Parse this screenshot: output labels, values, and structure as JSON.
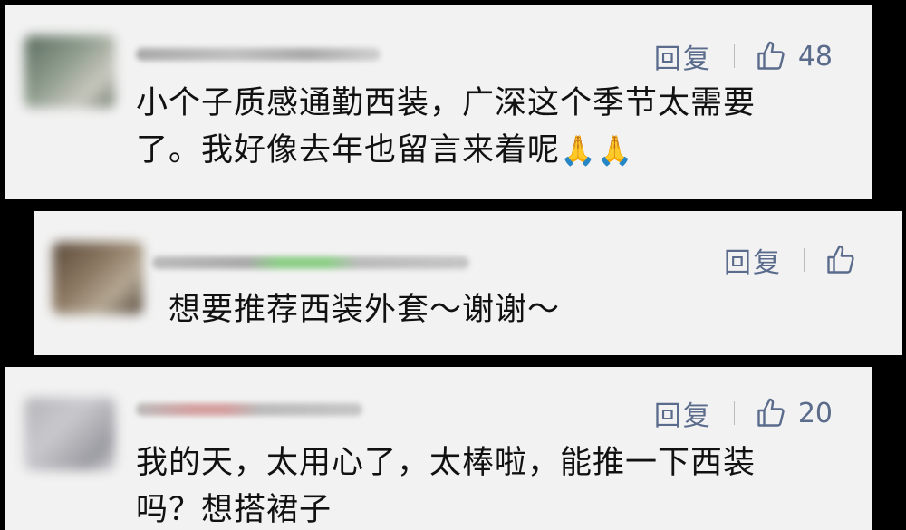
{
  "comments": [
    {
      "reply_label": "回复",
      "likes": "48",
      "text_line1": "小个子质感通勤西装，广深这个季节太需要",
      "text_line2": "了。我好像去年也留言来着呢",
      "emoji": "🙏🙏"
    },
    {
      "reply_label": "回复",
      "likes": "",
      "text_line1": "想要推荐西装外套～谢谢～"
    },
    {
      "reply_label": "回复",
      "likes": "20",
      "text_line1": "我的天，太用心了，太棒啦，能推一下西装",
      "text_line2": "吗？想搭裙子"
    }
  ],
  "colors": {
    "accent": "#5a6b8c",
    "card_bg": "#f2f2f2",
    "page_bg": "#000000",
    "text": "#111111"
  },
  "icons": {
    "like": "thumbs-up-icon"
  }
}
